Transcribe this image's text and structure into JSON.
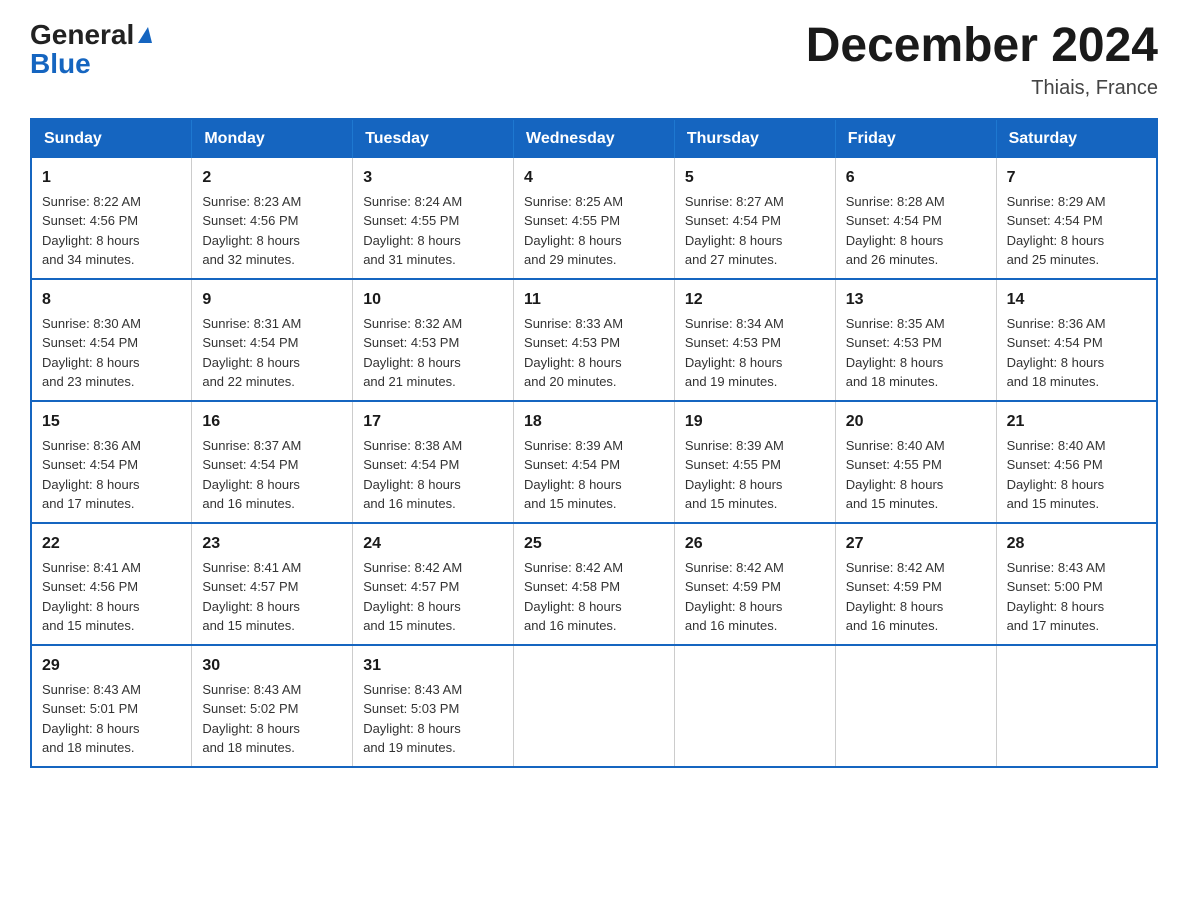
{
  "logo": {
    "line1": "General",
    "line2": "Blue"
  },
  "header": {
    "title": "December 2024",
    "location": "Thiais, France"
  },
  "weekdays": [
    "Sunday",
    "Monday",
    "Tuesday",
    "Wednesday",
    "Thursday",
    "Friday",
    "Saturday"
  ],
  "weeks": [
    [
      {
        "day": "1",
        "sunrise": "8:22 AM",
        "sunset": "4:56 PM",
        "daylight_hours": "8 hours",
        "daylight_minutes": "and 34 minutes."
      },
      {
        "day": "2",
        "sunrise": "8:23 AM",
        "sunset": "4:56 PM",
        "daylight_hours": "8 hours",
        "daylight_minutes": "and 32 minutes."
      },
      {
        "day": "3",
        "sunrise": "8:24 AM",
        "sunset": "4:55 PM",
        "daylight_hours": "8 hours",
        "daylight_minutes": "and 31 minutes."
      },
      {
        "day": "4",
        "sunrise": "8:25 AM",
        "sunset": "4:55 PM",
        "daylight_hours": "8 hours",
        "daylight_minutes": "and 29 minutes."
      },
      {
        "day": "5",
        "sunrise": "8:27 AM",
        "sunset": "4:54 PM",
        "daylight_hours": "8 hours",
        "daylight_minutes": "and 27 minutes."
      },
      {
        "day": "6",
        "sunrise": "8:28 AM",
        "sunset": "4:54 PM",
        "daylight_hours": "8 hours",
        "daylight_minutes": "and 26 minutes."
      },
      {
        "day": "7",
        "sunrise": "8:29 AM",
        "sunset": "4:54 PM",
        "daylight_hours": "8 hours",
        "daylight_minutes": "and 25 minutes."
      }
    ],
    [
      {
        "day": "8",
        "sunrise": "8:30 AM",
        "sunset": "4:54 PM",
        "daylight_hours": "8 hours",
        "daylight_minutes": "and 23 minutes."
      },
      {
        "day": "9",
        "sunrise": "8:31 AM",
        "sunset": "4:54 PM",
        "daylight_hours": "8 hours",
        "daylight_minutes": "and 22 minutes."
      },
      {
        "day": "10",
        "sunrise": "8:32 AM",
        "sunset": "4:53 PM",
        "daylight_hours": "8 hours",
        "daylight_minutes": "and 21 minutes."
      },
      {
        "day": "11",
        "sunrise": "8:33 AM",
        "sunset": "4:53 PM",
        "daylight_hours": "8 hours",
        "daylight_minutes": "and 20 minutes."
      },
      {
        "day": "12",
        "sunrise": "8:34 AM",
        "sunset": "4:53 PM",
        "daylight_hours": "8 hours",
        "daylight_minutes": "and 19 minutes."
      },
      {
        "day": "13",
        "sunrise": "8:35 AM",
        "sunset": "4:53 PM",
        "daylight_hours": "8 hours",
        "daylight_minutes": "and 18 minutes."
      },
      {
        "day": "14",
        "sunrise": "8:36 AM",
        "sunset": "4:54 PM",
        "daylight_hours": "8 hours",
        "daylight_minutes": "and 18 minutes."
      }
    ],
    [
      {
        "day": "15",
        "sunrise": "8:36 AM",
        "sunset": "4:54 PM",
        "daylight_hours": "8 hours",
        "daylight_minutes": "and 17 minutes."
      },
      {
        "day": "16",
        "sunrise": "8:37 AM",
        "sunset": "4:54 PM",
        "daylight_hours": "8 hours",
        "daylight_minutes": "and 16 minutes."
      },
      {
        "day": "17",
        "sunrise": "8:38 AM",
        "sunset": "4:54 PM",
        "daylight_hours": "8 hours",
        "daylight_minutes": "and 16 minutes."
      },
      {
        "day": "18",
        "sunrise": "8:39 AM",
        "sunset": "4:54 PM",
        "daylight_hours": "8 hours",
        "daylight_minutes": "and 15 minutes."
      },
      {
        "day": "19",
        "sunrise": "8:39 AM",
        "sunset": "4:55 PM",
        "daylight_hours": "8 hours",
        "daylight_minutes": "and 15 minutes."
      },
      {
        "day": "20",
        "sunrise": "8:40 AM",
        "sunset": "4:55 PM",
        "daylight_hours": "8 hours",
        "daylight_minutes": "and 15 minutes."
      },
      {
        "day": "21",
        "sunrise": "8:40 AM",
        "sunset": "4:56 PM",
        "daylight_hours": "8 hours",
        "daylight_minutes": "and 15 minutes."
      }
    ],
    [
      {
        "day": "22",
        "sunrise": "8:41 AM",
        "sunset": "4:56 PM",
        "daylight_hours": "8 hours",
        "daylight_minutes": "and 15 minutes."
      },
      {
        "day": "23",
        "sunrise": "8:41 AM",
        "sunset": "4:57 PM",
        "daylight_hours": "8 hours",
        "daylight_minutes": "and 15 minutes."
      },
      {
        "day": "24",
        "sunrise": "8:42 AM",
        "sunset": "4:57 PM",
        "daylight_hours": "8 hours",
        "daylight_minutes": "and 15 minutes."
      },
      {
        "day": "25",
        "sunrise": "8:42 AM",
        "sunset": "4:58 PM",
        "daylight_hours": "8 hours",
        "daylight_minutes": "and 16 minutes."
      },
      {
        "day": "26",
        "sunrise": "8:42 AM",
        "sunset": "4:59 PM",
        "daylight_hours": "8 hours",
        "daylight_minutes": "and 16 minutes."
      },
      {
        "day": "27",
        "sunrise": "8:42 AM",
        "sunset": "4:59 PM",
        "daylight_hours": "8 hours",
        "daylight_minutes": "and 16 minutes."
      },
      {
        "day": "28",
        "sunrise": "8:43 AM",
        "sunset": "5:00 PM",
        "daylight_hours": "8 hours",
        "daylight_minutes": "and 17 minutes."
      }
    ],
    [
      {
        "day": "29",
        "sunrise": "8:43 AM",
        "sunset": "5:01 PM",
        "daylight_hours": "8 hours",
        "daylight_minutes": "and 18 minutes."
      },
      {
        "day": "30",
        "sunrise": "8:43 AM",
        "sunset": "5:02 PM",
        "daylight_hours": "8 hours",
        "daylight_minutes": "and 18 minutes."
      },
      {
        "day": "31",
        "sunrise": "8:43 AM",
        "sunset": "5:03 PM",
        "daylight_hours": "8 hours",
        "daylight_minutes": "and 19 minutes."
      },
      null,
      null,
      null,
      null
    ]
  ]
}
